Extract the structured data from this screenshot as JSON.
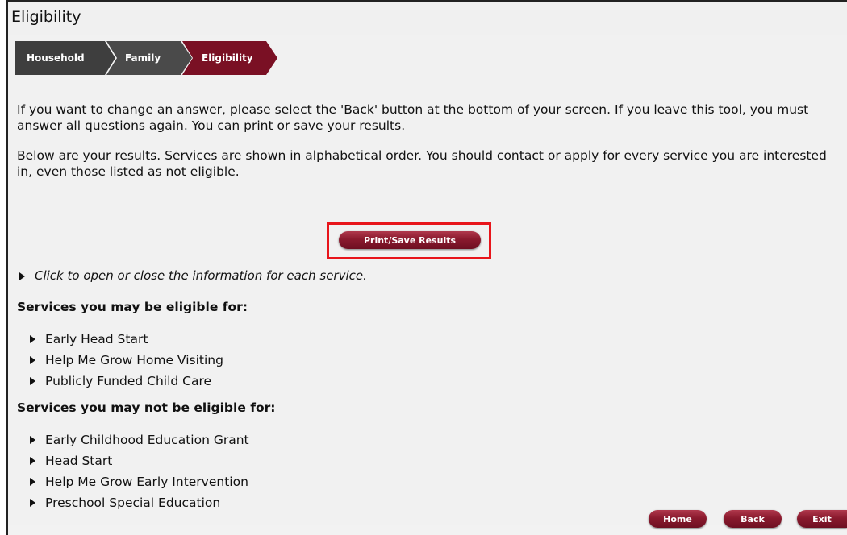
{
  "page": {
    "title": "Eligibility"
  },
  "steps": [
    {
      "label": "Household"
    },
    {
      "label": "Family"
    },
    {
      "label": "Eligibility"
    }
  ],
  "intro": {
    "paragraph1": "If you want to change an answer, please select the 'Back' button at the bottom of your screen. If you leave this tool, you must answer all questions again. You can print or save your results.",
    "paragraph2": "Below are your results. Services are shown in alphabetical order. You should contact or apply for every service you are interested in, even those listed as not eligible."
  },
  "print_button": {
    "label": "Print/Save Results"
  },
  "hint": "Click to open or close the information for each service.",
  "eligible": {
    "heading": "Services you may be eligible for:",
    "items": [
      "Early Head Start",
      "Help Me Grow Home Visiting",
      "Publicly Funded Child Care"
    ]
  },
  "not_eligible": {
    "heading": "Services you may not be eligible for:",
    "items": [
      "Early Childhood Education Grant",
      "Head Start",
      "Help Me Grow Early Intervention",
      "Preschool Special Education"
    ]
  },
  "footer": {
    "home_label": "Home",
    "back_label": "Back",
    "exit_label": "Exit"
  },
  "colors": {
    "accent": "#7a1024",
    "highlight": "#e8151b",
    "step_dark": "#3e3e3e"
  },
  "icons": {
    "list_marker": "triangle-right-icon"
  }
}
